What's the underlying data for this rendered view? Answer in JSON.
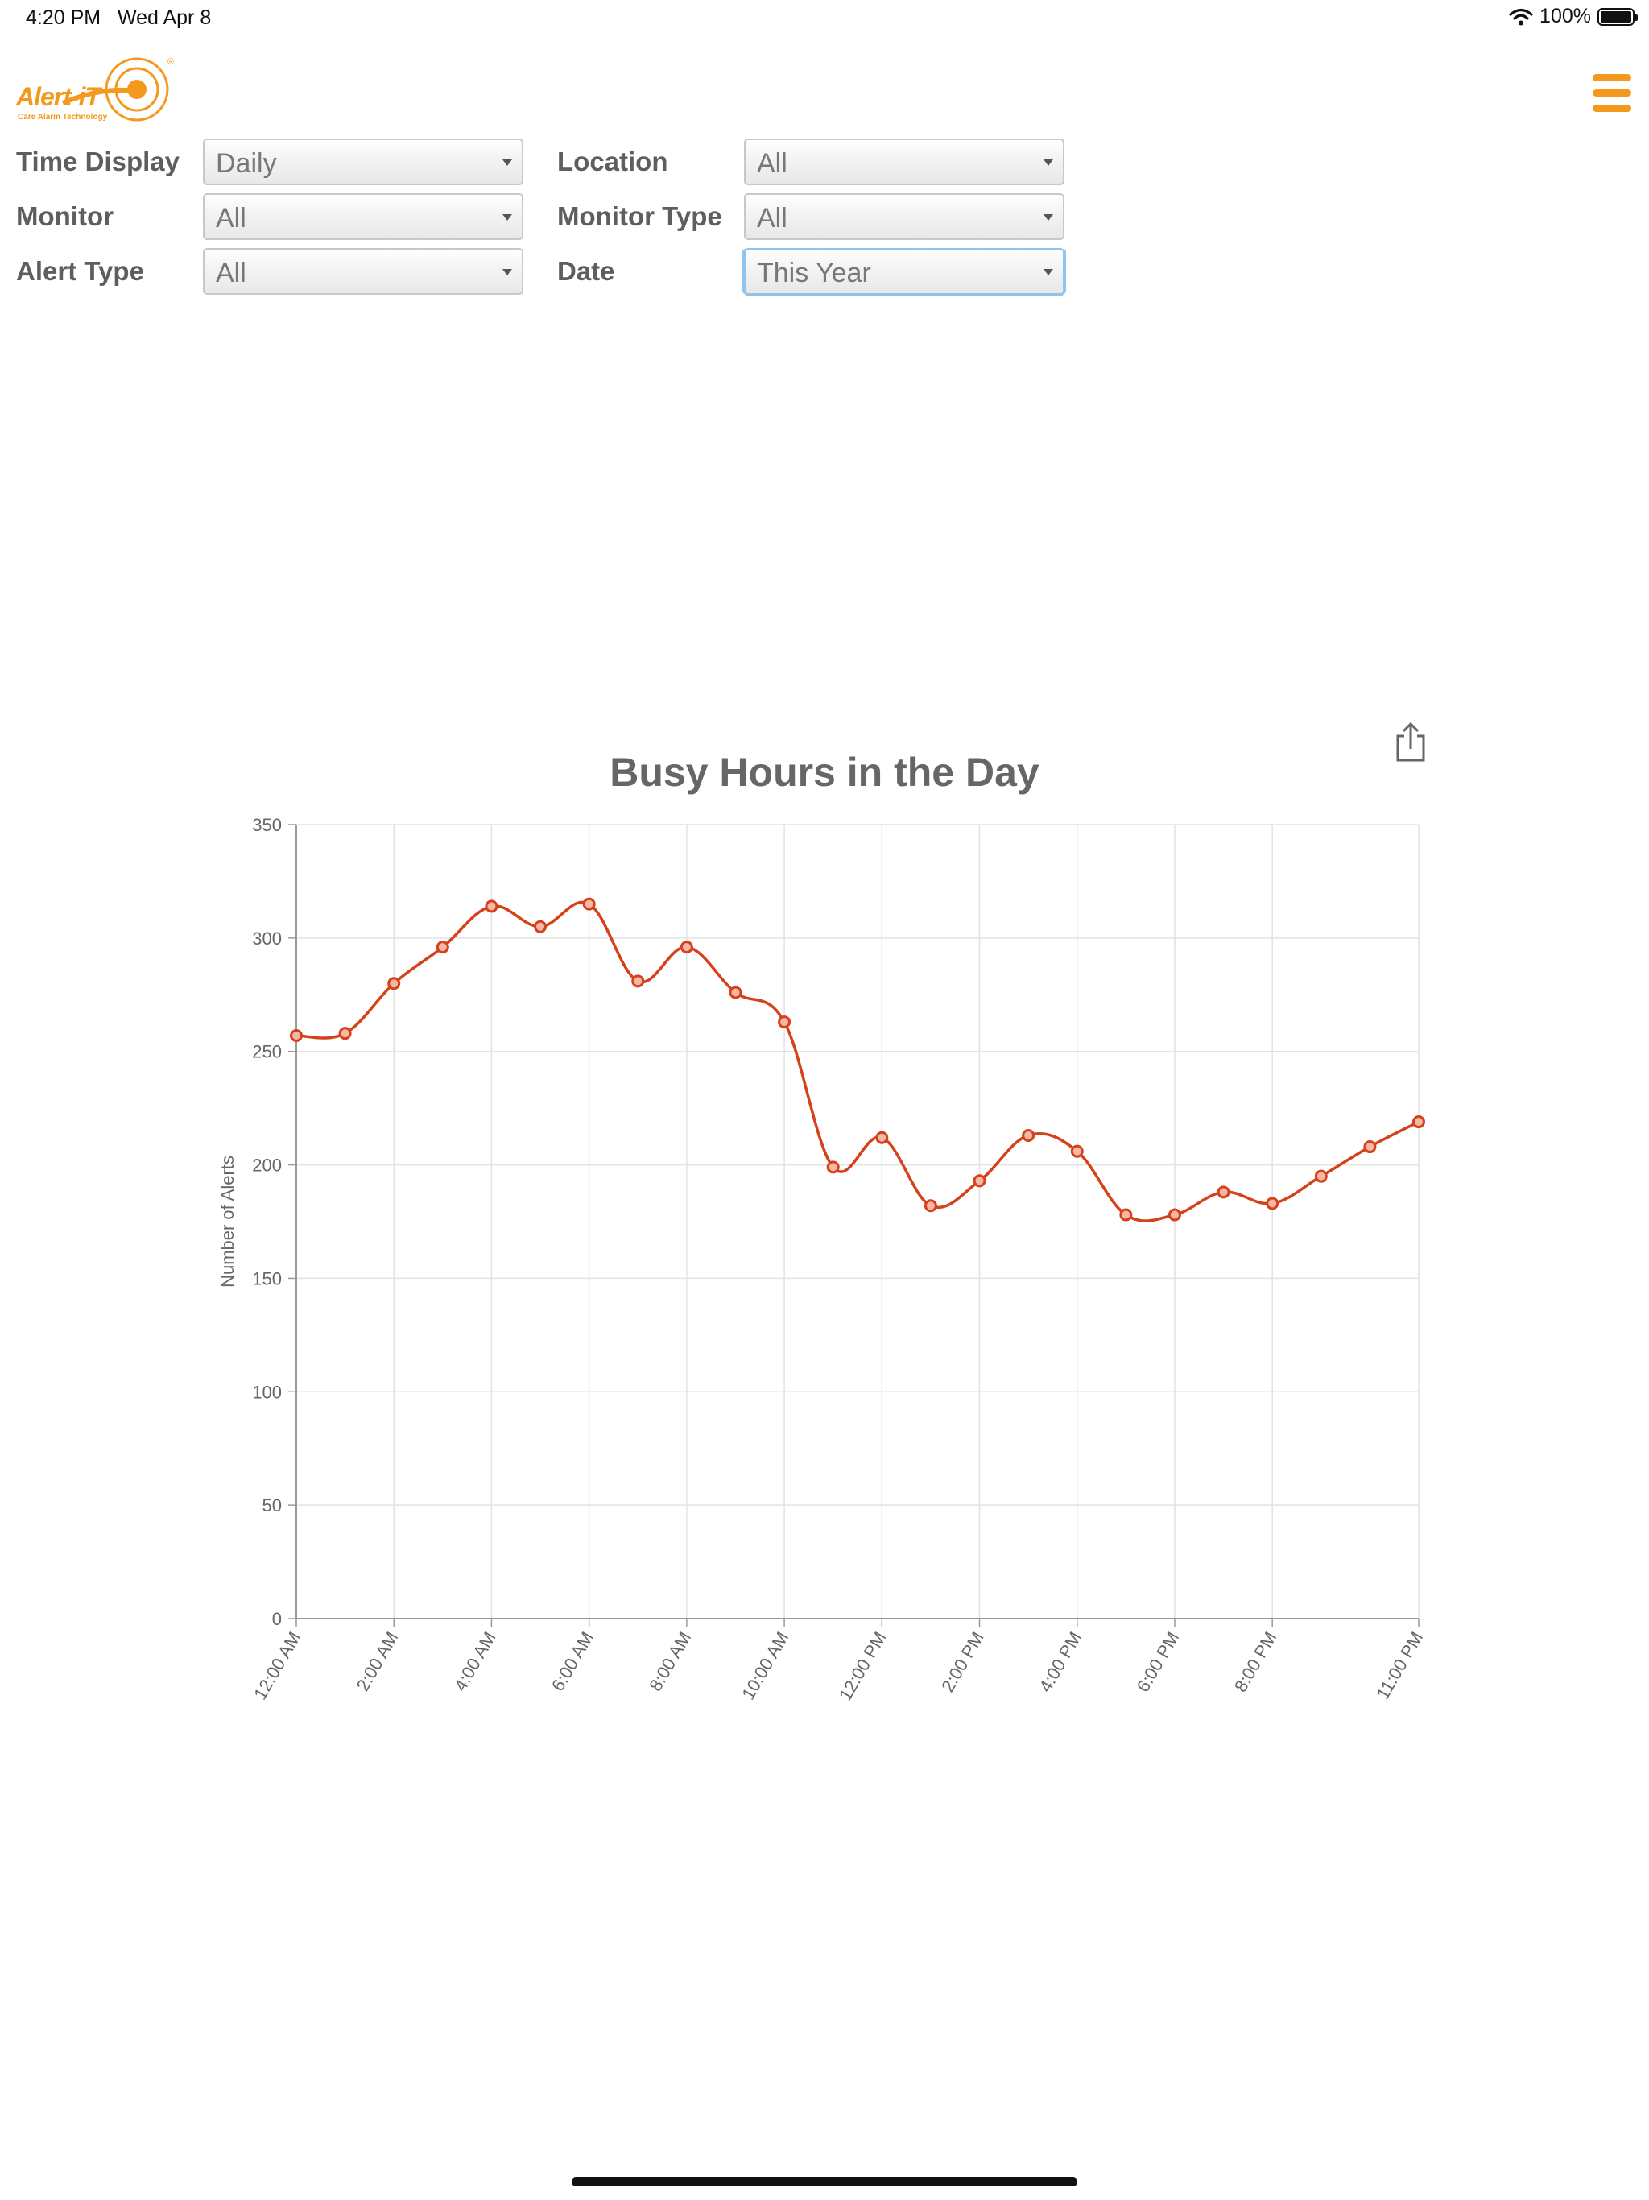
{
  "status_bar": {
    "time": "4:20 PM",
    "date": "Wed Apr 8",
    "wifi_icon": "wifi-icon",
    "battery_text": "100%",
    "battery_level": 1.0
  },
  "logo": {
    "name": "Alert-iT",
    "tagline": "Care Alarm Technology"
  },
  "menu_icon": "hamburger-menu-icon",
  "filters": {
    "time_display": {
      "label": "Time Display",
      "value": "Daily"
    },
    "location": {
      "label": "Location",
      "value": "All"
    },
    "monitor": {
      "label": "Monitor",
      "value": "All"
    },
    "monitor_type": {
      "label": "Monitor Type",
      "value": "All"
    },
    "alert_type": {
      "label": "Alert Type",
      "value": "All"
    },
    "date": {
      "label": "Date",
      "value": "This Year"
    }
  },
  "share_icon": "share-icon",
  "colors": {
    "accent": "#f39a1e",
    "line": "#d4411a"
  },
  "chart_data": {
    "type": "line",
    "title": "Busy Hours in the Day",
    "xlabel": "",
    "ylabel": "Number of Alerts",
    "ylim": [
      0,
      350
    ],
    "yticks": [
      0,
      50,
      100,
      150,
      200,
      250,
      300,
      350
    ],
    "grid": true,
    "legend": "none",
    "x": [
      "12:00 AM",
      "1:00 AM",
      "2:00 AM",
      "3:00 AM",
      "4:00 AM",
      "5:00 AM",
      "6:00 AM",
      "7:00 AM",
      "8:00 AM",
      "9:00 AM",
      "10:00 AM",
      "11:00 AM",
      "12:00 PM",
      "1:00 PM",
      "2:00 PM",
      "3:00 PM",
      "4:00 PM",
      "5:00 PM",
      "6:00 PM",
      "7:00 PM",
      "8:00 PM",
      "9:00 PM",
      "10:00 PM",
      "11:00 PM"
    ],
    "xtick_labels": [
      "12:00 AM",
      "2:00 AM",
      "4:00 AM",
      "6:00 AM",
      "8:00 AM",
      "10:00 AM",
      "12:00 PM",
      "2:00 PM",
      "4:00 PM",
      "6:00 PM",
      "8:00 PM",
      "11:00 PM"
    ],
    "series": [
      {
        "values": [
          257,
          258,
          280,
          296,
          314,
          305,
          315,
          281,
          296,
          276,
          263,
          199,
          212,
          182,
          193,
          213,
          206,
          178,
          178,
          188,
          183,
          195,
          208,
          219
        ]
      }
    ]
  }
}
